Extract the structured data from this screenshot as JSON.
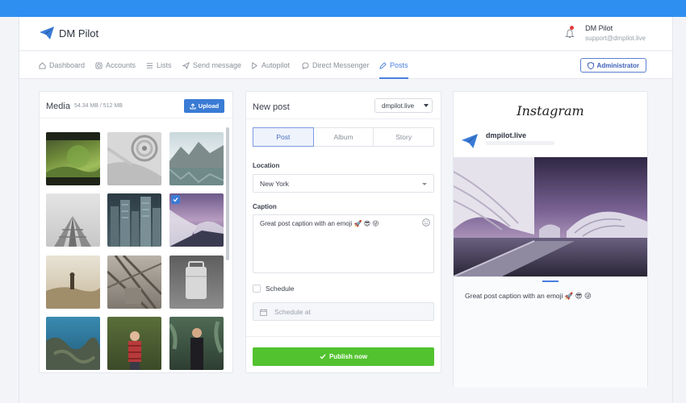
{
  "app": {
    "name": "DM Pilot",
    "user_name": "DM Pilot",
    "user_email": "support@dmpilot.live"
  },
  "nav": {
    "items": [
      {
        "label": "Dashboard",
        "icon": "home-icon"
      },
      {
        "label": "Accounts",
        "icon": "instagram-icon"
      },
      {
        "label": "Lists",
        "icon": "list-icon"
      },
      {
        "label": "Send message",
        "icon": "send-icon"
      },
      {
        "label": "Autopilot",
        "icon": "play-icon"
      },
      {
        "label": "Direct Messenger",
        "icon": "chat-icon"
      },
      {
        "label": "Posts",
        "icon": "pencil-icon",
        "active": true
      }
    ],
    "admin_label": "Administrator"
  },
  "media": {
    "title": "Media",
    "size": "54.34 MB / 512 MB",
    "upload_label": "Upload",
    "selected_index": 5
  },
  "post": {
    "title": "New post",
    "account": "dmpilot.live",
    "tabs": [
      "Post",
      "Album",
      "Story"
    ],
    "active_tab": "Post",
    "location_label": "Location",
    "location_value": "New York",
    "caption_label": "Caption",
    "caption_value": "Great post caption with an emoji 🚀 😎 😜",
    "schedule_label": "Schedule",
    "schedule_placeholder": "Schedule at",
    "publish_label": "Publish now"
  },
  "preview": {
    "brand": "Instagram",
    "username": "dmpilot.live",
    "caption": "Great post caption with an emoji 🚀 😎 😜"
  },
  "colors": {
    "accent": "#3a7bd5",
    "publish": "#53c22f",
    "topbar": "#2f8ff0"
  }
}
